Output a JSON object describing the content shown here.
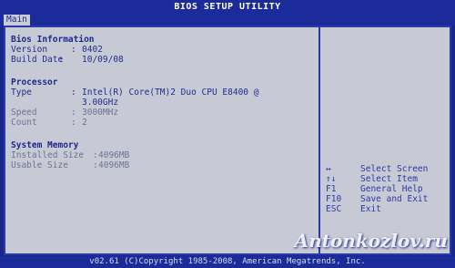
{
  "title_bar": {
    "title": "BIOS SETUP UTILITY"
  },
  "tabs": [
    {
      "label": "Main",
      "active": true
    }
  ],
  "bios_info": {
    "heading": "Bios Information",
    "version_label": "Version",
    "version_sep": ":",
    "version_value": "0402",
    "build_date_label": "Build Date",
    "build_date_sep": ":",
    "build_date_value": "10/09/08"
  },
  "processor": {
    "heading": "Processor",
    "type_label": "Type",
    "type_sep": ":",
    "type_value_line1": "Intel(R) Core(TM)2 Duo CPU E8400 @",
    "type_value_line2": "3.00GHz",
    "speed_label": "Speed",
    "speed_sep": ":",
    "speed_value": "3000MHz",
    "count_label": "Count",
    "count_sep": ":",
    "count_value": "2"
  },
  "system_memory": {
    "heading": "System Memory",
    "installed_label": "Installed Size",
    "installed_sep": ":",
    "installed_value": "4096MB",
    "usable_label": "Usable Size",
    "usable_sep": ":",
    "usable_value": "4096MB"
  },
  "help_keys": [
    {
      "key": "↔",
      "action": "Select Screen"
    },
    {
      "key": "↑↓",
      "action": "Select Item"
    },
    {
      "key": "F1",
      "action": "General Help"
    },
    {
      "key": "F10",
      "action": "Save and Exit"
    },
    {
      "key": "ESC",
      "action": "Exit"
    }
  ],
  "footer": {
    "text": "v02.61 (C)Copyright 1985-2008, American Megatrends, Inc."
  },
  "watermark": {
    "text": "Antonkozlov.ru"
  },
  "colors": {
    "background": "#19268a",
    "panel": "#c7c9d4",
    "accent_text": "#1f2f8f",
    "dim_text": "#6e7396"
  }
}
